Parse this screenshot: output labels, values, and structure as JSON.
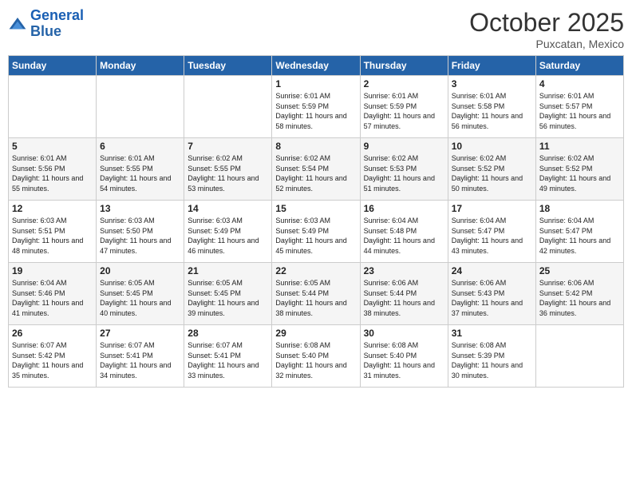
{
  "header": {
    "logo_line1": "General",
    "logo_line2": "Blue",
    "month": "October 2025",
    "location": "Puxcatan, Mexico"
  },
  "days_of_week": [
    "Sunday",
    "Monday",
    "Tuesday",
    "Wednesday",
    "Thursday",
    "Friday",
    "Saturday"
  ],
  "weeks": [
    [
      {
        "day": "",
        "info": ""
      },
      {
        "day": "",
        "info": ""
      },
      {
        "day": "",
        "info": ""
      },
      {
        "day": "1",
        "info": "Sunrise: 6:01 AM\nSunset: 5:59 PM\nDaylight: 11 hours\nand 58 minutes."
      },
      {
        "day": "2",
        "info": "Sunrise: 6:01 AM\nSunset: 5:59 PM\nDaylight: 11 hours\nand 57 minutes."
      },
      {
        "day": "3",
        "info": "Sunrise: 6:01 AM\nSunset: 5:58 PM\nDaylight: 11 hours\nand 56 minutes."
      },
      {
        "day": "4",
        "info": "Sunrise: 6:01 AM\nSunset: 5:57 PM\nDaylight: 11 hours\nand 56 minutes."
      }
    ],
    [
      {
        "day": "5",
        "info": "Sunrise: 6:01 AM\nSunset: 5:56 PM\nDaylight: 11 hours\nand 55 minutes."
      },
      {
        "day": "6",
        "info": "Sunrise: 6:01 AM\nSunset: 5:55 PM\nDaylight: 11 hours\nand 54 minutes."
      },
      {
        "day": "7",
        "info": "Sunrise: 6:02 AM\nSunset: 5:55 PM\nDaylight: 11 hours\nand 53 minutes."
      },
      {
        "day": "8",
        "info": "Sunrise: 6:02 AM\nSunset: 5:54 PM\nDaylight: 11 hours\nand 52 minutes."
      },
      {
        "day": "9",
        "info": "Sunrise: 6:02 AM\nSunset: 5:53 PM\nDaylight: 11 hours\nand 51 minutes."
      },
      {
        "day": "10",
        "info": "Sunrise: 6:02 AM\nSunset: 5:52 PM\nDaylight: 11 hours\nand 50 minutes."
      },
      {
        "day": "11",
        "info": "Sunrise: 6:02 AM\nSunset: 5:52 PM\nDaylight: 11 hours\nand 49 minutes."
      }
    ],
    [
      {
        "day": "12",
        "info": "Sunrise: 6:03 AM\nSunset: 5:51 PM\nDaylight: 11 hours\nand 48 minutes."
      },
      {
        "day": "13",
        "info": "Sunrise: 6:03 AM\nSunset: 5:50 PM\nDaylight: 11 hours\nand 47 minutes."
      },
      {
        "day": "14",
        "info": "Sunrise: 6:03 AM\nSunset: 5:49 PM\nDaylight: 11 hours\nand 46 minutes."
      },
      {
        "day": "15",
        "info": "Sunrise: 6:03 AM\nSunset: 5:49 PM\nDaylight: 11 hours\nand 45 minutes."
      },
      {
        "day": "16",
        "info": "Sunrise: 6:04 AM\nSunset: 5:48 PM\nDaylight: 11 hours\nand 44 minutes."
      },
      {
        "day": "17",
        "info": "Sunrise: 6:04 AM\nSunset: 5:47 PM\nDaylight: 11 hours\nand 43 minutes."
      },
      {
        "day": "18",
        "info": "Sunrise: 6:04 AM\nSunset: 5:47 PM\nDaylight: 11 hours\nand 42 minutes."
      }
    ],
    [
      {
        "day": "19",
        "info": "Sunrise: 6:04 AM\nSunset: 5:46 PM\nDaylight: 11 hours\nand 41 minutes."
      },
      {
        "day": "20",
        "info": "Sunrise: 6:05 AM\nSunset: 5:45 PM\nDaylight: 11 hours\nand 40 minutes."
      },
      {
        "day": "21",
        "info": "Sunrise: 6:05 AM\nSunset: 5:45 PM\nDaylight: 11 hours\nand 39 minutes."
      },
      {
        "day": "22",
        "info": "Sunrise: 6:05 AM\nSunset: 5:44 PM\nDaylight: 11 hours\nand 38 minutes."
      },
      {
        "day": "23",
        "info": "Sunrise: 6:06 AM\nSunset: 5:44 PM\nDaylight: 11 hours\nand 38 minutes."
      },
      {
        "day": "24",
        "info": "Sunrise: 6:06 AM\nSunset: 5:43 PM\nDaylight: 11 hours\nand 37 minutes."
      },
      {
        "day": "25",
        "info": "Sunrise: 6:06 AM\nSunset: 5:42 PM\nDaylight: 11 hours\nand 36 minutes."
      }
    ],
    [
      {
        "day": "26",
        "info": "Sunrise: 6:07 AM\nSunset: 5:42 PM\nDaylight: 11 hours\nand 35 minutes."
      },
      {
        "day": "27",
        "info": "Sunrise: 6:07 AM\nSunset: 5:41 PM\nDaylight: 11 hours\nand 34 minutes."
      },
      {
        "day": "28",
        "info": "Sunrise: 6:07 AM\nSunset: 5:41 PM\nDaylight: 11 hours\nand 33 minutes."
      },
      {
        "day": "29",
        "info": "Sunrise: 6:08 AM\nSunset: 5:40 PM\nDaylight: 11 hours\nand 32 minutes."
      },
      {
        "day": "30",
        "info": "Sunrise: 6:08 AM\nSunset: 5:40 PM\nDaylight: 11 hours\nand 31 minutes."
      },
      {
        "day": "31",
        "info": "Sunrise: 6:08 AM\nSunset: 5:39 PM\nDaylight: 11 hours\nand 30 minutes."
      },
      {
        "day": "",
        "info": ""
      }
    ]
  ]
}
